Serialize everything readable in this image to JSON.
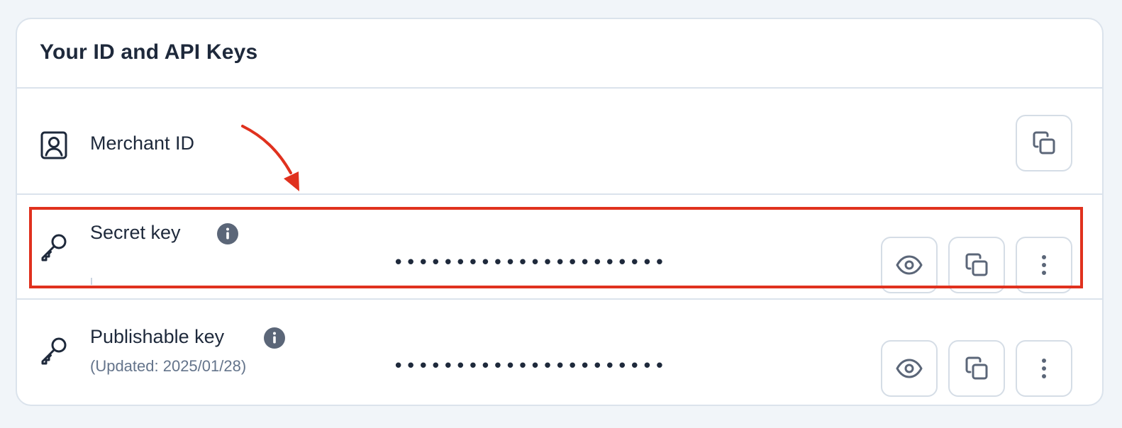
{
  "card": {
    "title": "Your ID and API Keys"
  },
  "rows": {
    "merchant": {
      "label": "Merchant ID",
      "icon": "user-badge-icon",
      "actions": [
        "copy-icon"
      ]
    },
    "secret": {
      "label": "Secret key",
      "icon": "key-icon",
      "masked_value": "••••••••••••••••••••••",
      "actions": [
        "eye-icon",
        "copy-icon",
        "more-vertical-icon"
      ]
    },
    "publishable": {
      "label": "Publishable key",
      "icon": "key-icon",
      "updated": "(Updated: 2025/01/28)",
      "masked_value": "••••••••••••••••••••••",
      "actions": [
        "eye-icon",
        "copy-icon",
        "more-vertical-icon"
      ]
    }
  },
  "annotation": {
    "color": "#e0311e"
  },
  "colors": {
    "text": "#1e293b",
    "muted": "#64748b",
    "border": "#dbe3ec",
    "info_icon": "#5b6678"
  }
}
